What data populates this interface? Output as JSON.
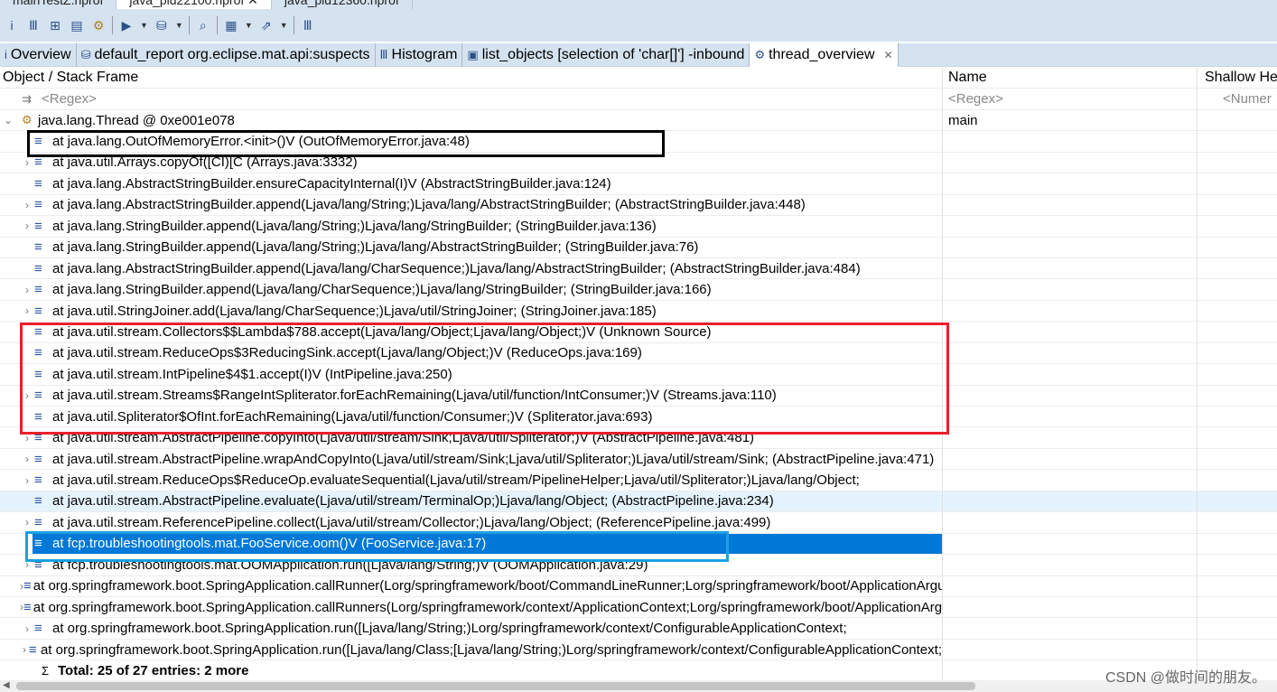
{
  "editor_tabs": [
    {
      "label": "mainTestZ.hprof"
    },
    {
      "label": "java_pid22100.hprof ✕"
    },
    {
      "label": "java_pid12360.hprof"
    }
  ],
  "toolbar_icons": [
    "info-icon",
    "histogram-icon",
    "dominator-tree-icon",
    "oql-icon",
    "thread-icon",
    "query-browser-icon",
    "reports-icon",
    "search-icon",
    "calculator-icon",
    "export-icon",
    "heap-dump-icon"
  ],
  "view_tabs": [
    {
      "icon": "i",
      "label": "Overview"
    },
    {
      "icon": "⛁",
      "label": "default_report  org.eclipse.mat.api:suspects"
    },
    {
      "icon": "Ⅲ",
      "label": "Histogram"
    },
    {
      "icon": "▣",
      "label": "list_objects  [selection of 'char[]'] -inbound"
    },
    {
      "icon": "⚙",
      "label": "thread_overview",
      "close": "✕"
    }
  ],
  "columns": {
    "frame": "Object / Stack Frame",
    "name": "Name",
    "shallow": "Shallow He",
    "regex": "<Regex>",
    "numeric": "<Numer"
  },
  "thread": {
    "label": "java.lang.Thread @ 0xe001e078",
    "name": "main"
  },
  "frames": [
    {
      "t": "at java.lang.OutOfMemoryError.<init>()V (OutOfMemoryError.java:48)",
      "e": false
    },
    {
      "t": "at java.util.Arrays.copyOf([CI)[C (Arrays.java:3332)",
      "e": true
    },
    {
      "t": "at java.lang.AbstractStringBuilder.ensureCapacityInternal(I)V (AbstractStringBuilder.java:124)",
      "e": false
    },
    {
      "t": "at java.lang.AbstractStringBuilder.append(Ljava/lang/String;)Ljava/lang/AbstractStringBuilder; (AbstractStringBuilder.java:448)",
      "e": true
    },
    {
      "t": "at java.lang.StringBuilder.append(Ljava/lang/String;)Ljava/lang/StringBuilder; (StringBuilder.java:136)",
      "e": true
    },
    {
      "t": "at java.lang.StringBuilder.append(Ljava/lang/String;)Ljava/lang/AbstractStringBuilder; (StringBuilder.java:76)",
      "e": false
    },
    {
      "t": "at java.lang.AbstractStringBuilder.append(Ljava/lang/CharSequence;)Ljava/lang/AbstractStringBuilder; (AbstractStringBuilder.java:484)",
      "e": false
    },
    {
      "t": "at java.lang.StringBuilder.append(Ljava/lang/CharSequence;)Ljava/lang/StringBuilder; (StringBuilder.java:166)",
      "e": true
    },
    {
      "t": "at java.util.StringJoiner.add(Ljava/lang/CharSequence;)Ljava/util/StringJoiner; (StringJoiner.java:185)",
      "e": true
    },
    {
      "t": "at java.util.stream.Collectors$$Lambda$788.accept(Ljava/lang/Object;Ljava/lang/Object;)V (Unknown Source)",
      "e": false
    },
    {
      "t": "at java.util.stream.ReduceOps$3ReducingSink.accept(Ljava/lang/Object;)V (ReduceOps.java:169)",
      "e": false
    },
    {
      "t": "at java.util.stream.IntPipeline$4$1.accept(I)V (IntPipeline.java:250)",
      "e": false
    },
    {
      "t": "at java.util.stream.Streams$RangeIntSpliterator.forEachRemaining(Ljava/util/function/IntConsumer;)V (Streams.java:110)",
      "e": true
    },
    {
      "t": "at java.util.Spliterator$OfInt.forEachRemaining(Ljava/util/function/Consumer;)V (Spliterator.java:693)",
      "e": false
    },
    {
      "t": "at java.util.stream.AbstractPipeline.copyInto(Ljava/util/stream/Sink;Ljava/util/Spliterator;)V (AbstractPipeline.java:481)",
      "e": true
    },
    {
      "t": "at java.util.stream.AbstractPipeline.wrapAndCopyInto(Ljava/util/stream/Sink;Ljava/util/Spliterator;)Ljava/util/stream/Sink; (AbstractPipeline.java:471)",
      "e": true
    },
    {
      "t": "at java.util.stream.ReduceOps$ReduceOp.evaluateSequential(Ljava/util/stream/PipelineHelper;Ljava/util/Spliterator;)Ljava/lang/Object;",
      "e": true
    },
    {
      "t": "at java.util.stream.AbstractPipeline.evaluate(Ljava/util/stream/TerminalOp;)Ljava/lang/Object; (AbstractPipeline.java:234)",
      "e": false,
      "hover": true
    },
    {
      "t": "at java.util.stream.ReferencePipeline.collect(Ljava/util/stream/Collector;)Ljava/lang/Object; (ReferencePipeline.java:499)",
      "e": true
    },
    {
      "t": "at fcp.troubleshootingtools.mat.FooService.oom()V (FooService.java:17)",
      "e": false,
      "selected": true
    },
    {
      "t": "at fcp.troubleshootingtools.mat.OOMApplication.run([Ljava/lang/String;)V (OOMApplication.java:29)",
      "e": true
    },
    {
      "t": "at org.springframework.boot.SpringApplication.callRunner(Lorg/springframework/boot/CommandLineRunner;Lorg/springframework/boot/ApplicationArguments;)V",
      "e": true
    },
    {
      "t": "at org.springframework.boot.SpringApplication.callRunners(Lorg/springframework/context/ApplicationContext;Lorg/springframework/boot/ApplicationArguments;)V",
      "e": true
    },
    {
      "t": "at org.springframework.boot.SpringApplication.run([Ljava/lang/String;)Lorg/springframework/context/ConfigurableApplicationContext;",
      "e": true
    },
    {
      "t": "at org.springframework.boot.SpringApplication.run([Ljava/lang/Class;[Ljava/lang/String;)Lorg/springframework/context/ConfigurableApplicationContext;",
      "e": true
    }
  ],
  "total": "Total: 25 of 27 entries: 2 more",
  "annotation_colors": {
    "black_box": "#000000",
    "red_box": "#e8202a",
    "blue_box": "#1aa0e0",
    "selection": "#0078d7"
  },
  "watermark": "CSDN @做时间的朋友。"
}
